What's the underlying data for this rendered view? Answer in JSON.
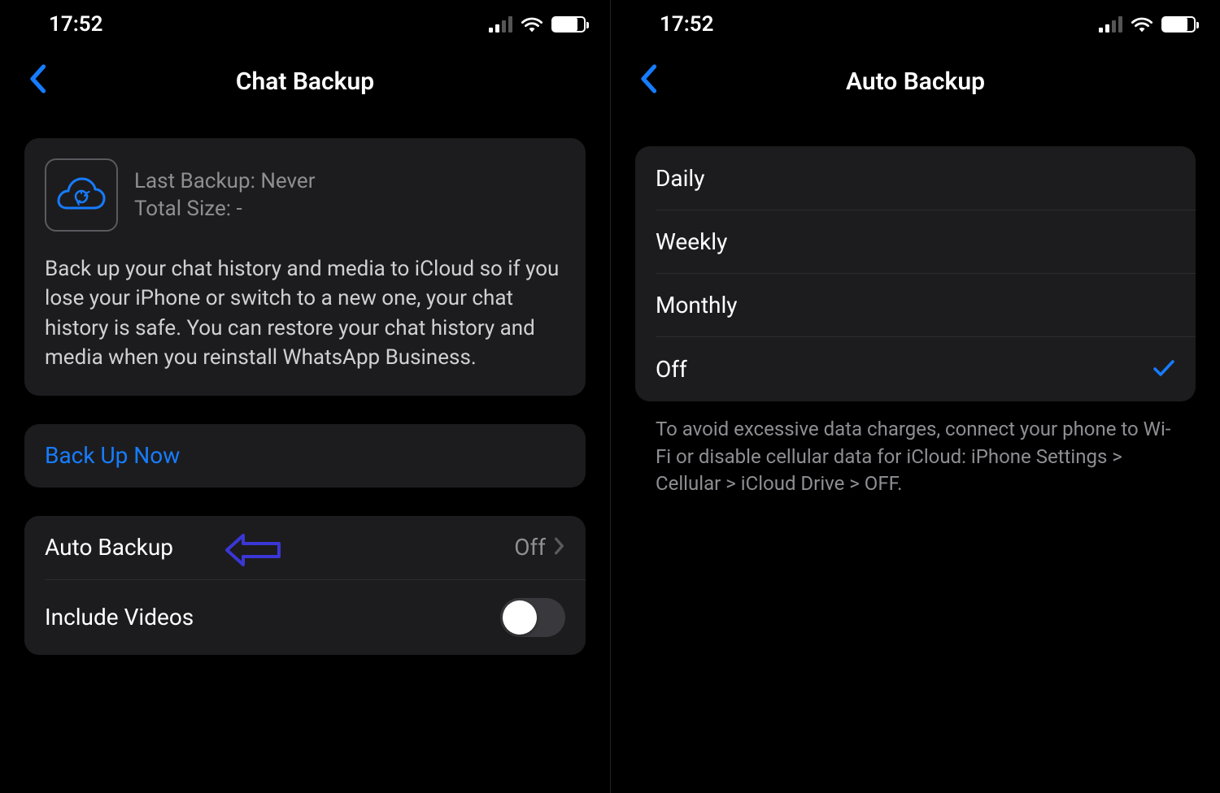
{
  "status": {
    "time": "17:52"
  },
  "left": {
    "title": "Chat Backup",
    "info": {
      "last_backup_label": "Last Backup: Never",
      "total_size_label": "Total Size: -",
      "description": "Back up your chat history and media to iCloud so if you lose your iPhone or switch to a new one, your chat history is safe. You can restore your chat history and media when you reinstall WhatsApp Business."
    },
    "backup_now_label": "Back Up Now",
    "auto_backup": {
      "label": "Auto Backup",
      "value": "Off"
    },
    "include_videos_label": "Include Videos"
  },
  "right": {
    "title": "Auto Backup",
    "options": {
      "daily": "Daily",
      "weekly": "Weekly",
      "monthly": "Monthly",
      "off": "Off"
    },
    "footer": "To avoid excessive data charges, connect your phone to Wi-Fi or disable cellular data for iCloud: iPhone Settings > Cellular > iCloud Drive > OFF."
  }
}
